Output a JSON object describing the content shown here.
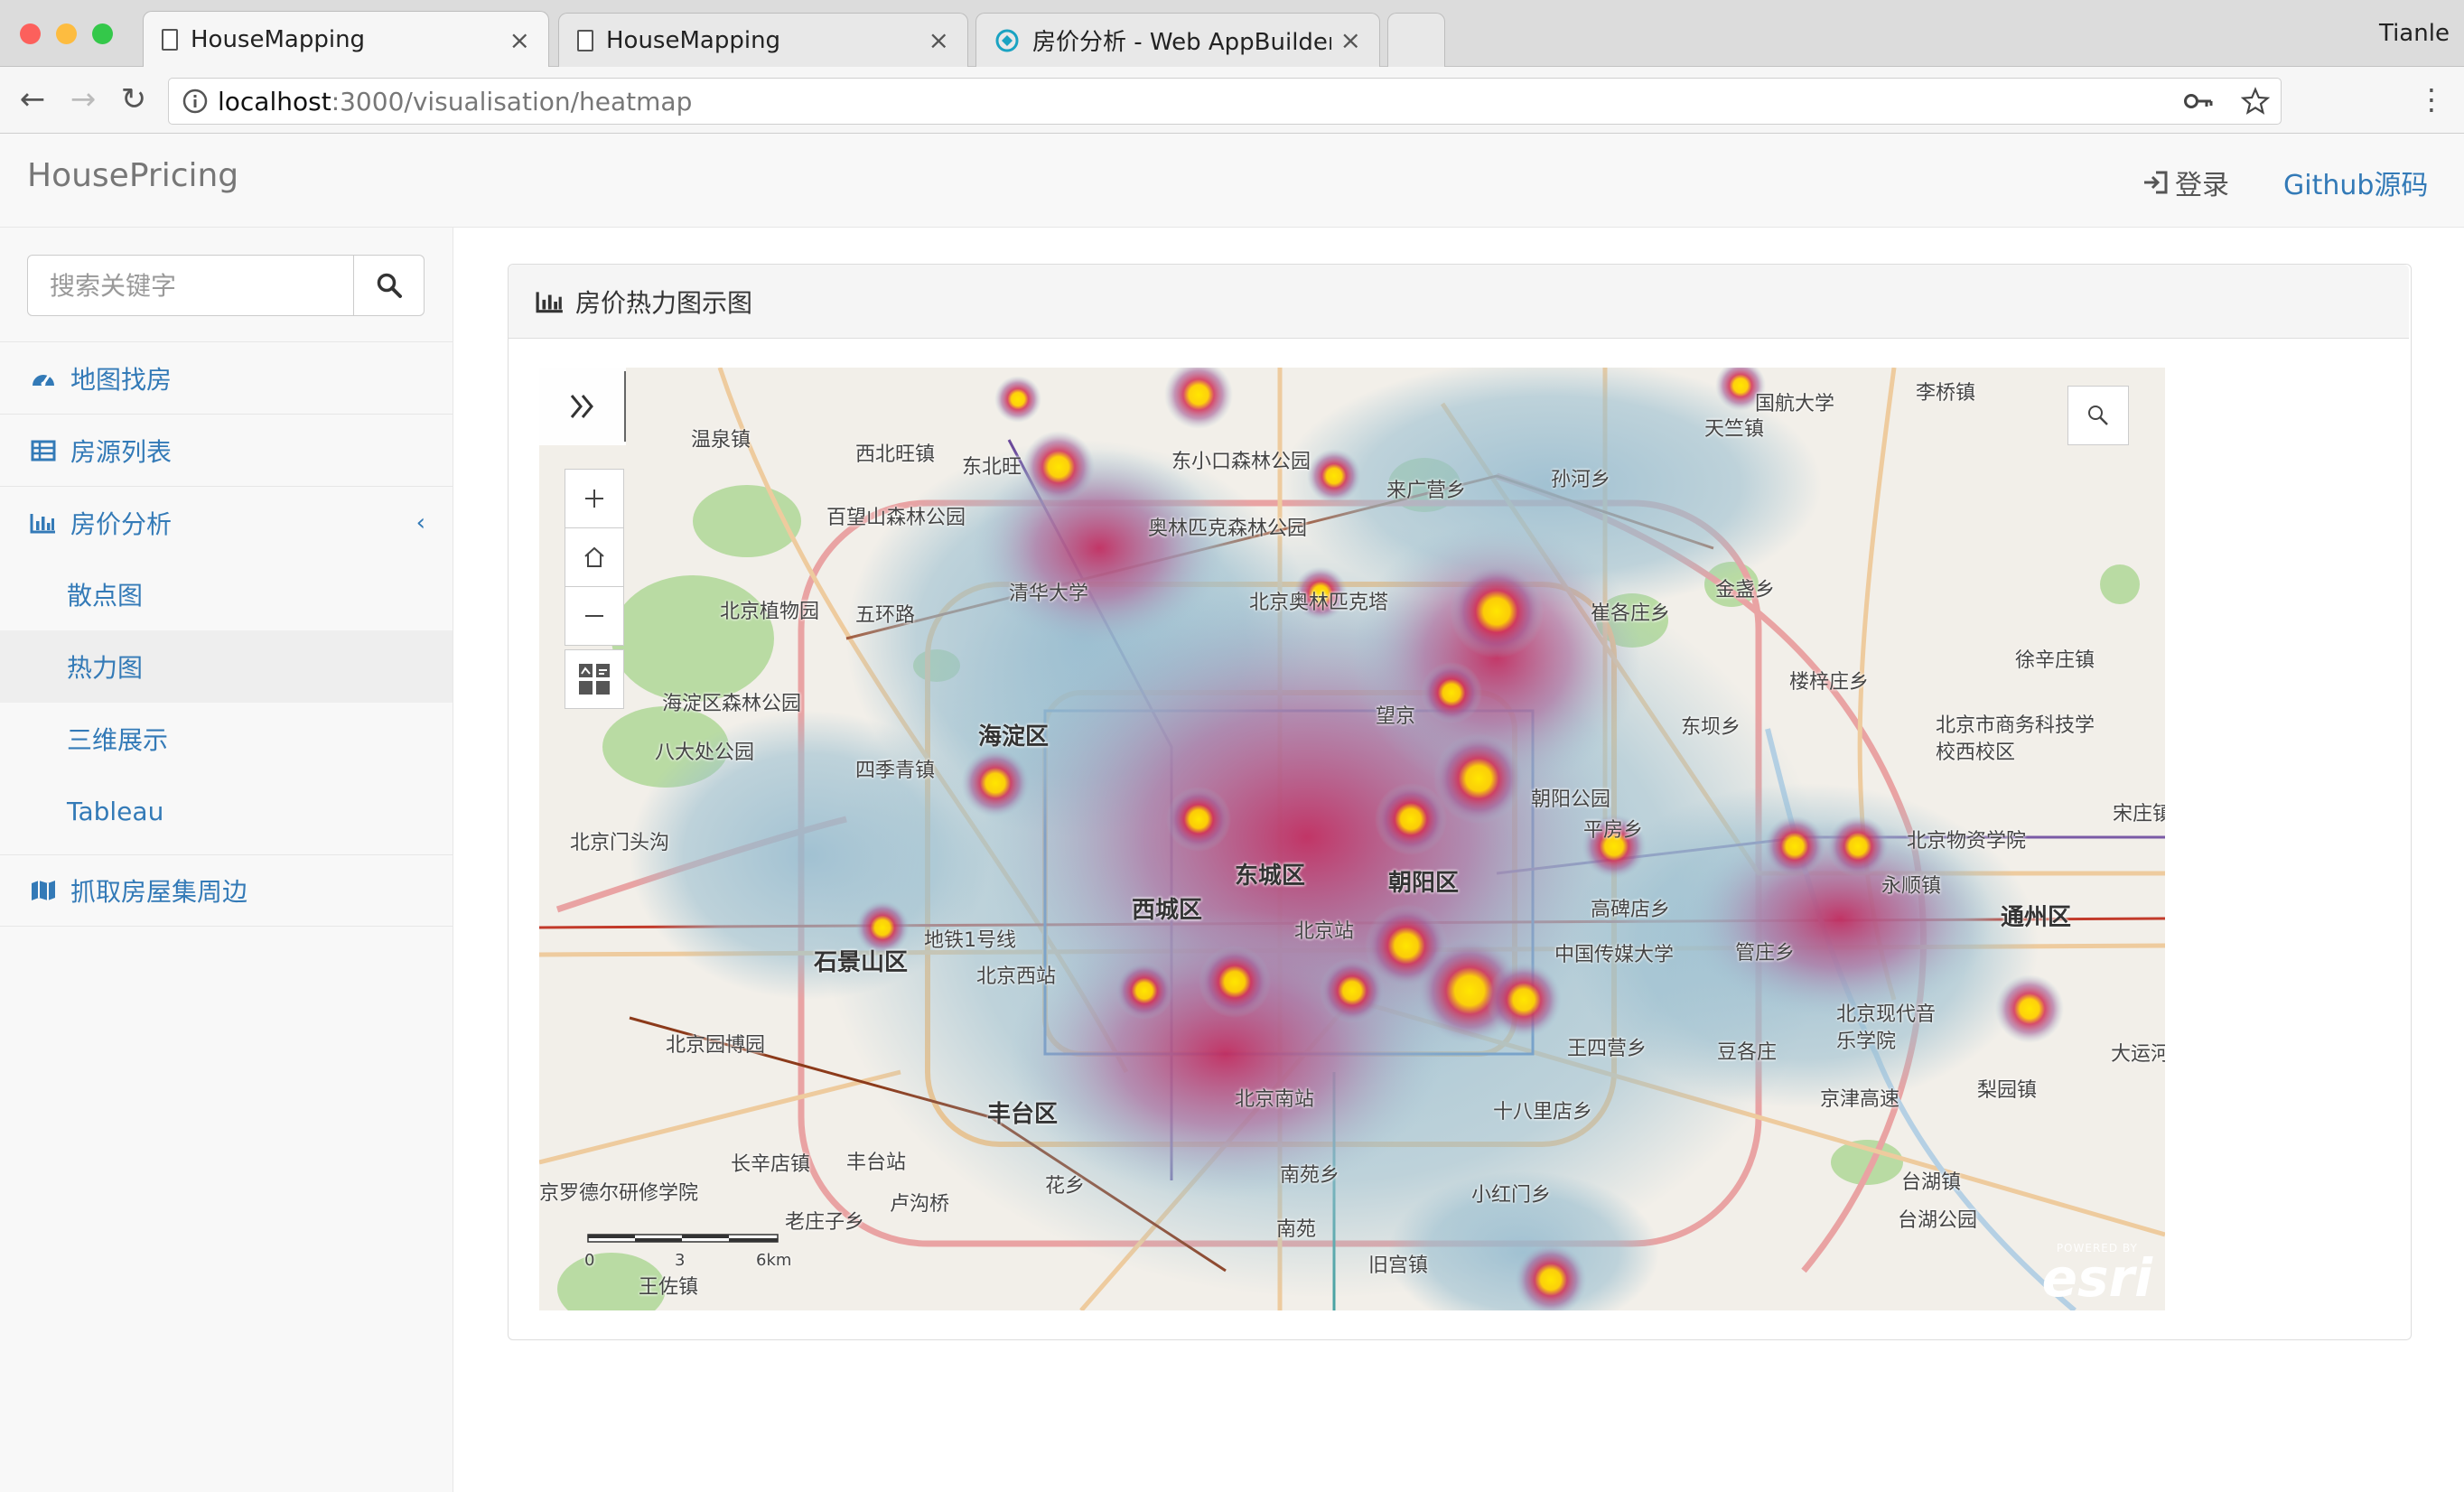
{
  "browser": {
    "user": "Tianle",
    "tabs": [
      {
        "title": "HouseMapping",
        "active": true
      },
      {
        "title": "HouseMapping",
        "active": false
      },
      {
        "title": "房价分析 - Web AppBuilder for",
        "active": false
      }
    ],
    "url_host": "localhost",
    "url_path": ":3000/visualisation/heatmap"
  },
  "app": {
    "brand": "HousePricing",
    "header": {
      "login_label": "登录",
      "github_label": "Github源码"
    },
    "search": {
      "placeholder": "搜索关键字"
    },
    "sidebar": {
      "items": [
        {
          "label": "地图找房",
          "icon": "dashboard-icon"
        },
        {
          "label": "房源列表",
          "icon": "table-icon"
        },
        {
          "label": "房价分析",
          "icon": "bar-chart-icon",
          "expanded": true
        },
        {
          "label": "抓取房屋集周边",
          "icon": "map-icon"
        }
      ],
      "sub_items": [
        {
          "label": "散点图",
          "active": false
        },
        {
          "label": "热力图",
          "active": true
        },
        {
          "label": "三维展示",
          "active": false
        },
        {
          "label": "Tableau",
          "active": false
        }
      ]
    },
    "panel": {
      "title": "房价热力图示图"
    }
  },
  "map": {
    "labels": [
      "温泉镇",
      "西北旺镇",
      "东北旺",
      "百望山森林公园",
      "清华大学",
      "北京植物园",
      "五环路",
      "海淀区森林公园",
      "八大处公园",
      "海淀区",
      "四季青镇",
      "北京门头沟",
      "石景山区",
      "北京西站",
      "北京园博园",
      "丰台区",
      "长辛店镇",
      "丰台站",
      "卢沟桥",
      "花乡",
      "京罗德尔研修学院",
      "东城区",
      "西城区",
      "朝阳区",
      "北京站",
      "北京南站",
      "南苑乡",
      "旧宫镇",
      "小红门乡",
      "十八里店乡",
      "王四营乡",
      "豆各庄",
      "中国传媒大学",
      "高碑店乡",
      "管庄乡",
      "平房乡",
      "东坝乡",
      "崔各庄乡",
      "金盏乡",
      "楼梓庄乡",
      "徐辛庄镇",
      "国航大学",
      "李桥镇",
      "天竺镇",
      "孙河乡",
      "来广营乡",
      "北京市商务科技学校西校区",
      "北京物资学院",
      "永顺镇",
      "通州区",
      "梨园镇",
      "北京现代音乐学院",
      "台湖镇",
      "台湖公园",
      "大运河",
      "宋庄镇",
      "东小口森林公园",
      "奥林匹克森林公园",
      "北京奥林匹克塔",
      "望京",
      "王佐镇",
      "老庄子乡",
      "京津高速",
      "地铁1号线",
      "朝阳公园",
      "南苑"
    ],
    "scale": {
      "ticks": [
        "0",
        "3",
        "6km"
      ]
    },
    "attribution": {
      "powered_by": "POWERED BY",
      "name": "esri"
    },
    "colors": {
      "heat_low": "#9bbfd0",
      "heat_mid": "#c0306a",
      "heat_high": "#ffe600"
    }
  }
}
